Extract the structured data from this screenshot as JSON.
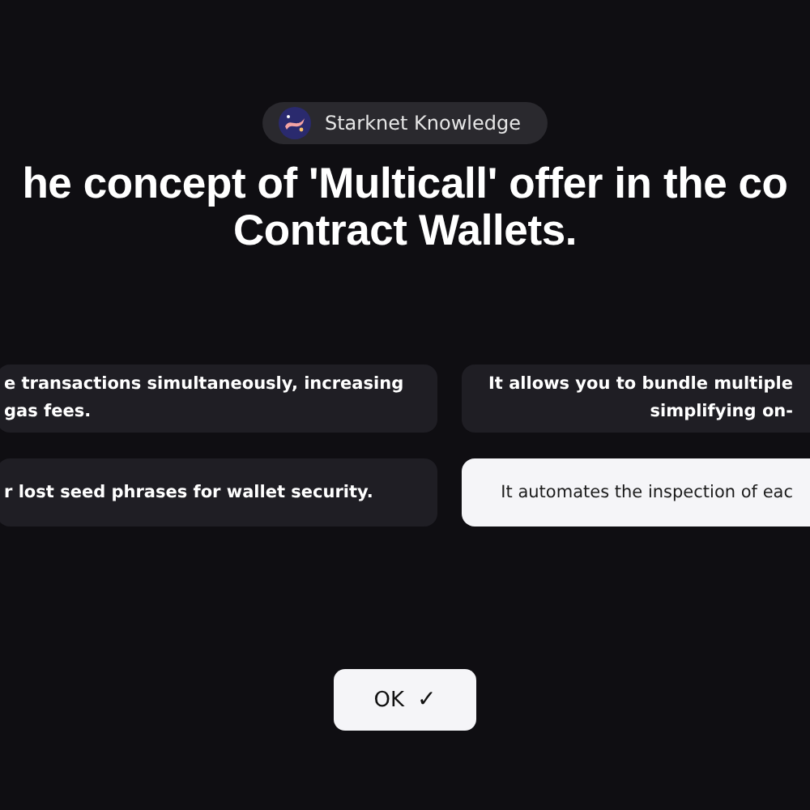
{
  "badge": {
    "label": "Starknet Knowledge"
  },
  "question": {
    "lines": [
      "he concept of 'Multicall' offer in the co",
      "Contract Wallets."
    ]
  },
  "options": [
    {
      "lines": [
        "e transactions simultaneously, increasing",
        "gas fees."
      ],
      "selected": false
    },
    {
      "lines": [
        "It allows you to bundle multiple",
        "simplifying on-"
      ],
      "selected": false
    },
    {
      "lines": [
        "r lost seed phrases for wallet security."
      ],
      "selected": false
    },
    {
      "lines": [
        "It automates the inspection of eac"
      ],
      "selected": true
    }
  ],
  "button": {
    "label": "OK",
    "icon": "✓"
  }
}
